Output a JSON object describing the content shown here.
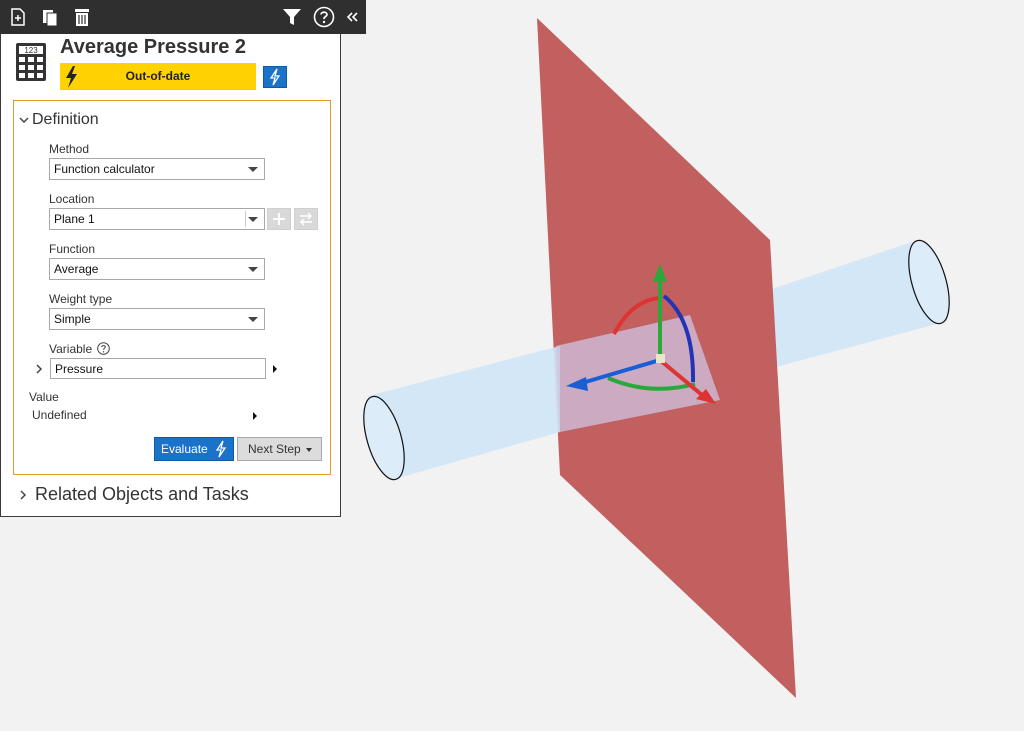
{
  "toolbar": {
    "new_icon": "new-document-icon",
    "copy_icon": "copy-icon",
    "delete_icon": "trash-icon",
    "filter_icon": "filter-icon",
    "help_icon": "help-icon",
    "collapse_icon": "collapse-left-icon"
  },
  "object": {
    "title": "Average Pressure 2",
    "icon": "calculator-icon",
    "status": "Out-of-date",
    "status_color": "#ffd200",
    "update_icon": "lightning-icon"
  },
  "definition": {
    "header": "Definition",
    "method": {
      "label": "Method",
      "value": "Function calculator"
    },
    "location": {
      "label": "Location",
      "value": "Plane 1"
    },
    "function": {
      "label": "Function",
      "value": "Average"
    },
    "weight_type": {
      "label": "Weight type",
      "value": "Simple"
    },
    "variable": {
      "label": "Variable",
      "value": "Pressure"
    },
    "value": {
      "label": "Value",
      "value": "Undefined"
    },
    "evaluate_label": "Evaluate",
    "next_step_label": "Next Step"
  },
  "related": {
    "header": "Related Objects and Tasks"
  },
  "colors": {
    "accent": "#1a73c8",
    "section_border": "#e39a2a",
    "plane": "#c26060",
    "cylinder": "#cfe6f7"
  }
}
